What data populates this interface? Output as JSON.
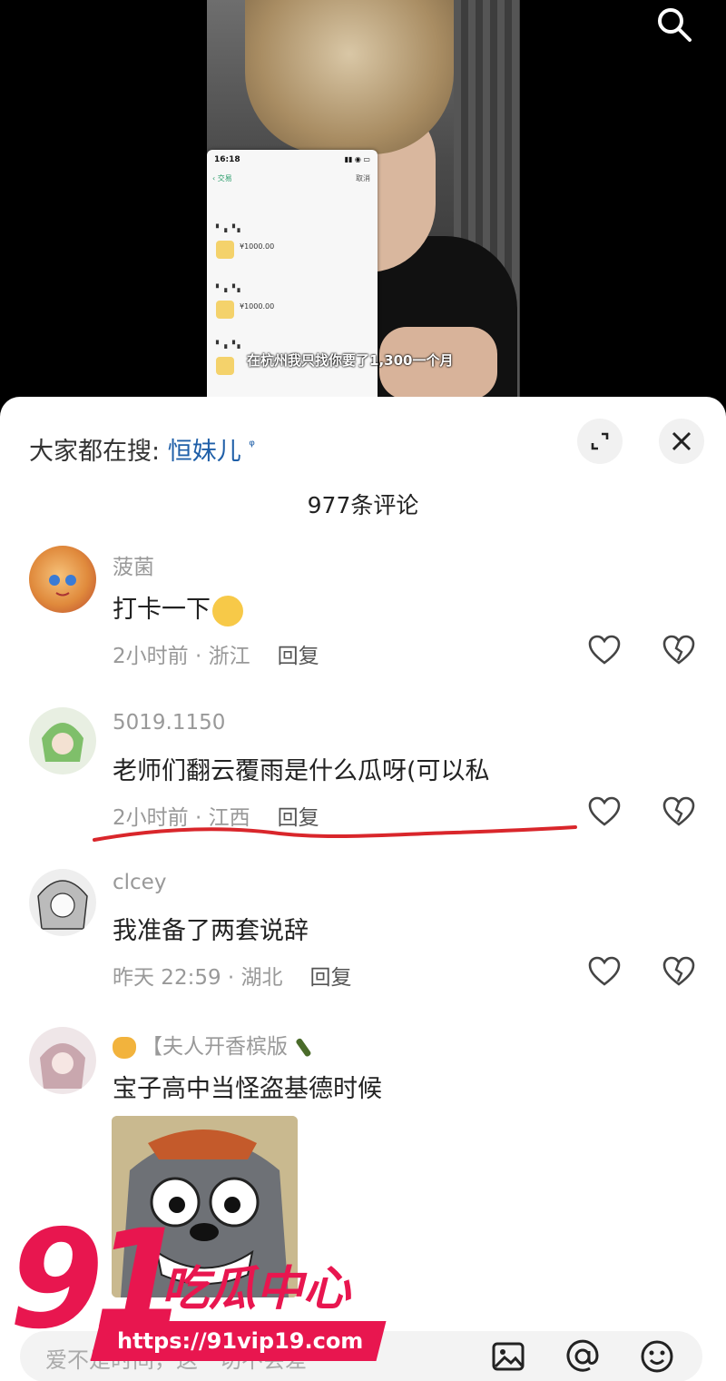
{
  "video": {
    "subtitle": "在杭州我只找你要了1,300一个月",
    "phone": {
      "time": "16:18",
      "nav_title": "交易",
      "nav_cancel": "取消",
      "amounts": [
        "¥1000.00",
        "¥1000.00"
      ]
    },
    "search_icon": "search-icon"
  },
  "sheet": {
    "search_prefix": "大家都在搜:",
    "search_term": "恒妹儿",
    "comment_count": "977条评论"
  },
  "comments": [
    {
      "author": "菠菌",
      "text": "打卡一下",
      "meta": "2小时前 · 浙江",
      "reply": "回复"
    },
    {
      "author": "5019.1150",
      "text": "老师们翻云覆雨是什么瓜呀(可以私",
      "meta": "2小时前 · 江西",
      "reply": "回复"
    },
    {
      "author": "clcey",
      "text": "我准备了两套说辞",
      "meta": "昨天 22:59 · 湖北",
      "reply": "回复"
    },
    {
      "author": "【夫人开香槟版",
      "text": "宝子高中当怪盗基德时候"
    }
  ],
  "input": {
    "placeholder": "爱不是时间，这一切不会差"
  },
  "watermark": {
    "number": "91",
    "brand": "吃瓜中心",
    "url": "https://91vip19.com"
  },
  "colors": {
    "brand_red": "#e8164f",
    "link_blue": "#1f5fa8",
    "annotation_red": "#d9262b"
  }
}
